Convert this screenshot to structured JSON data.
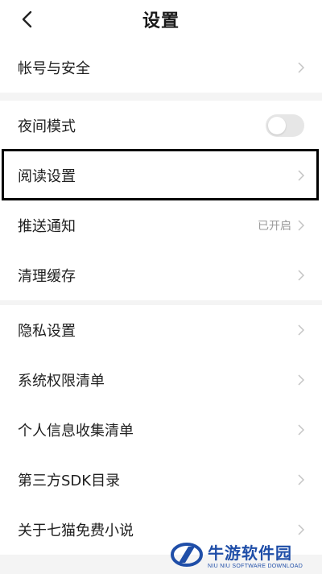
{
  "header": {
    "title": "设置",
    "back_icon": "chevron-left-icon"
  },
  "groups": [
    {
      "items": [
        {
          "label": "帐号与安全",
          "type": "link"
        }
      ]
    },
    {
      "items": [
        {
          "label": "夜间模式",
          "type": "toggle",
          "on": false
        },
        {
          "label": "阅读设置",
          "type": "link",
          "highlighted": true
        },
        {
          "label": "推送通知",
          "type": "link",
          "status": "已开启"
        },
        {
          "label": "清理缓存",
          "type": "link"
        }
      ]
    },
    {
      "items": [
        {
          "label": "隐私设置",
          "type": "link"
        },
        {
          "label": "系统权限清单",
          "type": "link"
        },
        {
          "label": "个人信息收集清单",
          "type": "link"
        },
        {
          "label": "第三方SDK目录",
          "type": "link"
        },
        {
          "label": "关于七猫免费小说",
          "type": "link"
        }
      ]
    }
  ],
  "watermark": {
    "name": "牛游软件园",
    "subtitle": "NIU NIU SOFTWARE DOWNLOAD"
  },
  "colors": {
    "background": "#ffffff",
    "separator": "#f4f4f4",
    "toggle_off": "#e6e6e6",
    "watermark": "#1f4ea8"
  }
}
